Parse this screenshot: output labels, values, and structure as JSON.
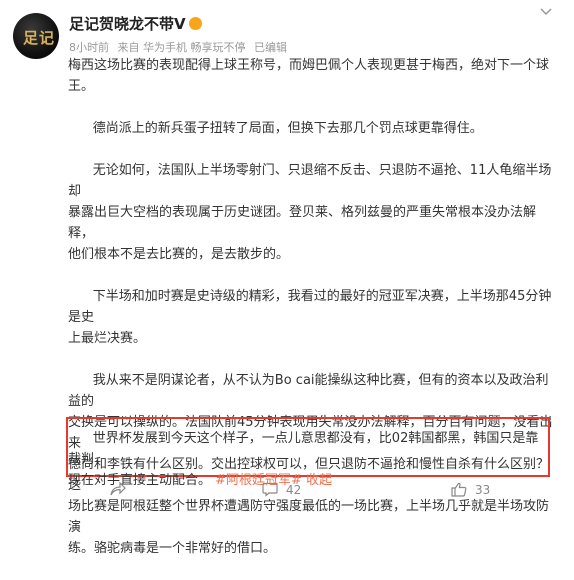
{
  "post": {
    "author": "足记贺晓龙不带V",
    "meta": {
      "time": "8小时前",
      "source": "来自 华为手机 畅享玩不停",
      "edited": "已编辑"
    },
    "paragraphs": [
      "梅西这场比赛的表现配得上球王称号，而姆巴佩个人表现更甚于梅西，绝对下一个球\n王。",
      "      德尚派上的新兵蛋子扭转了局面，但换下去那几个罚点球更靠得住。",
      "      无论如何，法国队上半场零射门、只退缩不反击、只退防不逼抢、11人龟缩半场却\n暴露出巨大空档的表现属于历史谜团。登贝莱、格列兹曼的严重失常根本没办法解释，\n他们根本不是去比赛的，是去散步的。",
      "      下半场和加时赛是史诗级的精彩，我看过的最好的冠亚军决赛，上半场那45分钟是史\n上最烂决赛。",
      "      我从来不是阴谋论者，从不认为Bo cai能操纵这种比赛，但有的资本以及政治利益的\n交换是可以操纵的。法国队前45分钟表现用失常没办法解释，百分百有问题，没看出来\n德尚和李铁有什么区别。交出控球权可以，但只退防不逼抢和慢性自杀有什么区别？这\n场比赛是阿根廷整个世界杯遭遇防守强度最低的一场比赛，上半场几乎就是半场攻防演\n练。骆驼病毒是一个非常好的借口。"
    ],
    "highlighted": {
      "text": "      世界杯发展到今天这个样子，一点儿意思都没有，比02韩国都黑，韩国只是靠裁判，\n现在对手直接主动配合。",
      "hashtag": "#阿根廷冠军#",
      "collapse": "收起"
    },
    "actions": {
      "share": "",
      "comments": "42",
      "likes": "33"
    }
  }
}
